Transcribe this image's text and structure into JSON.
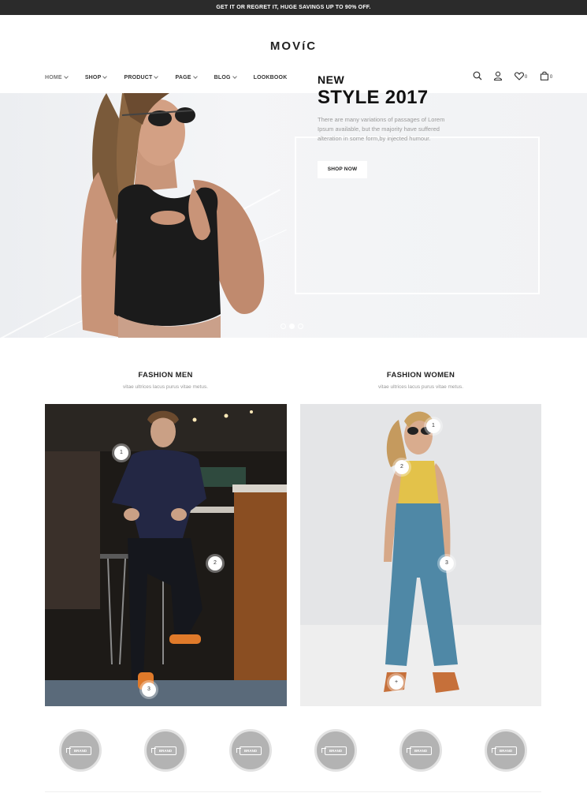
{
  "topbar": {
    "text": "GET IT OR REGRET IT, HUGE SAVINGS UP TO 90% OFF."
  },
  "brand": {
    "logo": "MOVíC"
  },
  "nav": {
    "items": [
      {
        "label": "HOME",
        "dropdown": true,
        "active": true
      },
      {
        "label": "SHOP",
        "dropdown": true
      },
      {
        "label": "PRODUCT",
        "dropdown": true
      },
      {
        "label": "PAGE",
        "dropdown": true
      },
      {
        "label": "BLOG",
        "dropdown": true
      },
      {
        "label": "LOOKBOOK",
        "dropdown": false
      }
    ]
  },
  "header_icons": {
    "search": "search-icon",
    "account": "user-icon",
    "wishlist": "heart-icon",
    "wishlist_count": "0",
    "cart": "bag-icon",
    "cart_count": "0"
  },
  "hero": {
    "eyebrow": "NEW",
    "title": "STYLE 2017",
    "description": "There are many variations of passages of Lorem Ipsum available, but the majority have suffered alteration in some form,by injected humour.",
    "cta": "SHOP NOW",
    "slides": 3,
    "active_slide": 2
  },
  "collections": [
    {
      "title": "FASHION MEN",
      "subtitle": "vitae ultrices lacus purus vitae metus.",
      "hotspots": [
        "1",
        "2",
        "3"
      ]
    },
    {
      "title": "FASHION WOMEN",
      "subtitle": "vitae ultrices lacus purus vitae metus.",
      "hotspots": [
        "1",
        "2",
        "3",
        "+"
      ]
    }
  ],
  "brands": {
    "label": "BRAND",
    "count": 6
  },
  "colors": {
    "topbar": "#2b2b2b",
    "accent": "#111111",
    "muted": "#999999"
  }
}
